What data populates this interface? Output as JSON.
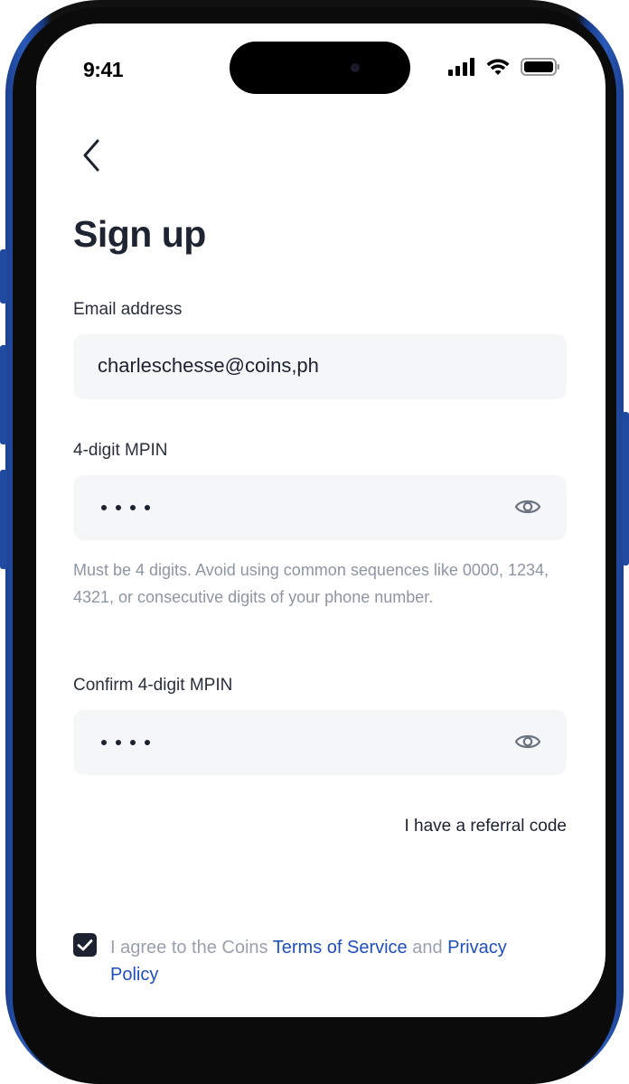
{
  "status_bar": {
    "time": "9:41"
  },
  "page": {
    "title": "Sign up"
  },
  "email": {
    "label": "Email address",
    "value": "charleschesse@coins,ph"
  },
  "mpin": {
    "label": "4-digit MPIN",
    "hint": "Must be 4 digits. Avoid using common sequences like 0000, 1234, 4321, or consecutive digits of your phone number."
  },
  "confirm_mpin": {
    "label": "Confirm 4-digit MPIN"
  },
  "referral": {
    "label": "I have a referral code"
  },
  "agreement": {
    "prefix": "I agree to the Coins ",
    "terms": "Terms of Service",
    "and": " and ",
    "privacy": "Privacy Policy",
    "checked": true
  },
  "colors": {
    "link": "#1f4fbf",
    "text": "#1c2230",
    "field_bg": "#f5f6f8"
  }
}
